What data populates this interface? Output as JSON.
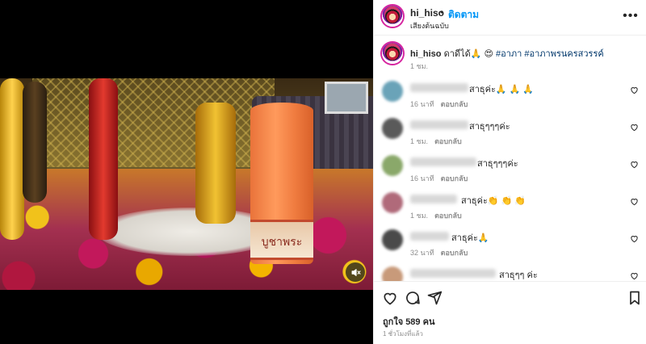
{
  "media": {
    "candle_text": "บูชาพระ"
  },
  "header": {
    "username": "hi_hiso",
    "separator": "•",
    "follow_label": "ติดตาม",
    "audio_label": "เสียงต้นฉบับ",
    "more_icon": "more-horizontal-icon"
  },
  "caption": {
    "username": "hi_hiso",
    "text": "ดาดีได้🙏 😍",
    "tags": "#อาภา #อาภาพรนครสวรรค์",
    "time": "1 ชม."
  },
  "comments": [
    {
      "text": "สาธุค่ะ🙏 🙏 🙏",
      "time": "16 นาที",
      "reply": "ตอบกลับ",
      "avatar_color": "#6aa3b8"
    },
    {
      "text": "สาธุๆๆๆค่ะ",
      "time": "1 ชม.",
      "reply": "ตอบกลับ",
      "avatar_color": "#5a5a5a"
    },
    {
      "text": "สาธุๆๆๆค่ะ",
      "time": "16 นาที",
      "reply": "ตอบกลับ",
      "avatar_color": "#8aa86a"
    },
    {
      "text": "สาธุค่ะ👏 👏 👏",
      "time": "1 ชม.",
      "reply": "ตอบกลับ",
      "avatar_color": "#b06a7a"
    },
    {
      "text": "สาธุค่ะ🙏",
      "time": "32 นาที",
      "reply": "ตอบกลับ",
      "avatar_color": "#4a4a4a"
    },
    {
      "text": "สาธุๆๆ ค่ะ",
      "time": "",
      "reply": "",
      "avatar_color": "#c89a7a"
    }
  ],
  "actions": {
    "like_icon": "heart-icon",
    "comment_icon": "comment-icon",
    "share_icon": "send-icon",
    "save_icon": "bookmark-icon"
  },
  "likes": "ถูกใจ 589 คน",
  "post_age": "1 ชั่วโมงที่แล้ว"
}
